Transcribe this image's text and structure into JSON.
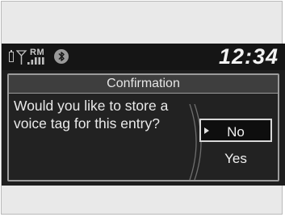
{
  "status_bar": {
    "roaming_label": "RM",
    "clock": "12:34",
    "icons": [
      "battery-icon",
      "signal-bars-icon",
      "bluetooth-icon"
    ]
  },
  "dialog": {
    "title": "Confirmation",
    "message": "Would you like to store a voice tag for this entry?",
    "options": [
      {
        "label": "No",
        "selected": true
      },
      {
        "label": "Yes",
        "selected": false
      }
    ]
  },
  "colors": {
    "screen_background": "#1e1e1e",
    "title_bar": "#3e3e3e",
    "text": "#eaeaea",
    "border": "#9c9c9c"
  }
}
